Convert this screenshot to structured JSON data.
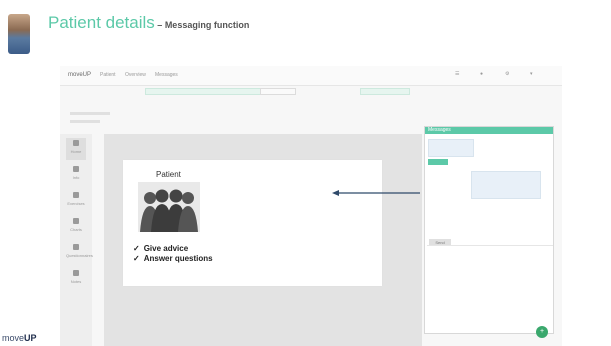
{
  "slide": {
    "title": "Patient details",
    "title_separator": " – ",
    "subtitle": "Messaging function",
    "brand_prefix": "move",
    "brand_suffix": "UP"
  },
  "card": {
    "title": "Patient",
    "items": [
      "Give advice",
      "Answer questions"
    ],
    "check_glyph": "✓"
  },
  "app": {
    "logo": "moveUP",
    "nav": [
      "Patient",
      "Overview",
      "Messages"
    ],
    "chat_header": "Messages",
    "chat_button": "Send",
    "fab_glyph": "+",
    "sidebar": [
      "Home",
      "Info",
      "Exercises",
      "Charts",
      "Questionnaires",
      "Notes"
    ]
  },
  "colors": {
    "accent": "#5cc9a8",
    "fab": "#3aa86d",
    "arrow": "#2f4a6a",
    "brand": "#1d2b4a"
  }
}
